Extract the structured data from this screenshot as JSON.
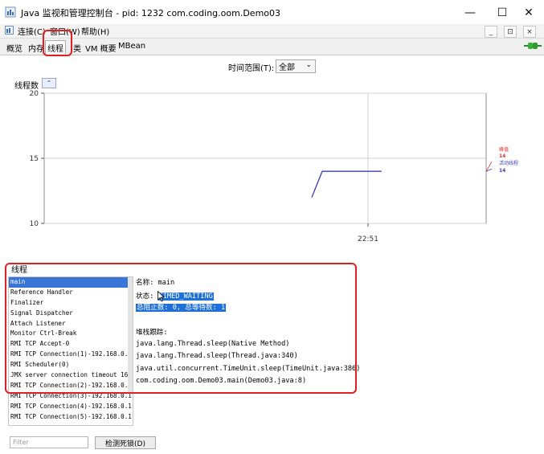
{
  "window": {
    "title": "Java 监视和管理控制台 - pid: 1232 com.coding.oom.Demo03",
    "minimize": "—",
    "maximize": "☐",
    "close": "✕"
  },
  "menubar": {
    "items": [
      "连接(C)",
      "窗口(W)",
      "帮助(H)"
    ],
    "mdi": [
      "_",
      "⊡",
      "×"
    ]
  },
  "tabs": [
    "概览",
    "内存",
    "线程",
    "类",
    "VM 概要",
    "MBean"
  ],
  "time_range": {
    "label": "时间范围(T):",
    "value": "全部"
  },
  "chart_panel": {
    "title": "线程数",
    "collapse": "⌃"
  },
  "chart_data": {
    "type": "line",
    "y_ticks": [
      10,
      15,
      20
    ],
    "x_tick": "22:51",
    "ylim": [
      10,
      20
    ],
    "series": [
      {
        "name": "峰值",
        "value": "14",
        "color": "#e03030"
      },
      {
        "name": "活动线程",
        "value": "14",
        "color": "#3c3cb4"
      }
    ],
    "line_points": [
      {
        "x": 0.0,
        "y": 12
      },
      {
        "x": 0.06,
        "y": 14
      },
      {
        "x": 0.4,
        "y": 14
      }
    ],
    "grid": true
  },
  "threads": {
    "label": "线程",
    "list": [
      "main",
      "Reference Handler",
      "Finalizer",
      "Signal Dispatcher",
      "Attach Listener",
      "Monitor Ctrl-Break",
      "RMI TCP Accept-0",
      "RMI TCP Connection(1)-192.168.0.1",
      "RMI Scheduler(0)",
      "JMX server connection timeout 16",
      "RMI TCP Connection(2)-192.168.0.1",
      "RMI TCP Connection(3)-192.168.0.1",
      "RMI TCP Connection(4)-192.168.0.1",
      "RMI TCP Connection(5)-192.168.0.1"
    ],
    "selected_index": 0,
    "detail": {
      "name_line": "名称: main",
      "state_label": "状态: ",
      "state_value": "TIMED_WAITING",
      "counts": "总阻止数: 0, 总等待数: 1",
      "stack_label": "堆栈跟踪:",
      "stack": [
        "java.lang.Thread.sleep(Native Method)",
        "java.lang.Thread.sleep(Thread.java:340)",
        "java.util.concurrent.TimeUnit.sleep(TimeUnit.java:386)",
        "com.coding.oom.Demo03.main(Demo03.java:8)"
      ]
    },
    "filter_placeholder": "Filter",
    "deadlock_button": "检测死锁(D)"
  }
}
